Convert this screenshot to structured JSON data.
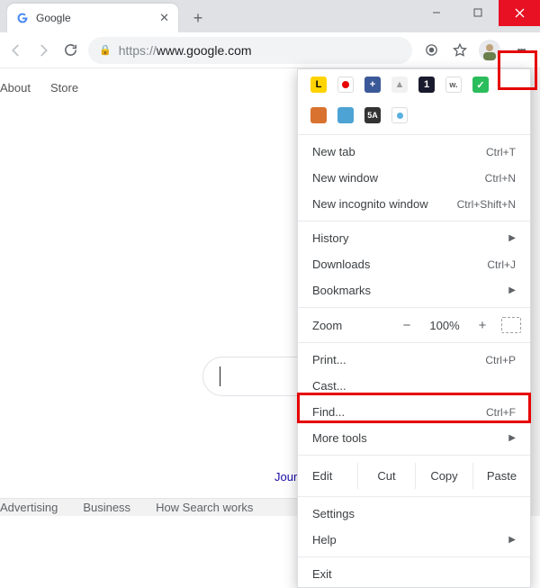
{
  "window": {
    "tab_title": "Google"
  },
  "toolbar": {
    "url_prefix": "https://",
    "url_rest": "www.google.com"
  },
  "page_nav": {
    "about": "About",
    "store": "Store"
  },
  "page": {
    "bottom_link": "Journ"
  },
  "footer": {
    "advertising": "Advertising",
    "business": "Business",
    "how_search": "How Search works"
  },
  "menu": {
    "new_tab": "New tab",
    "new_tab_sc": "Ctrl+T",
    "new_window": "New window",
    "new_window_sc": "Ctrl+N",
    "incognito": "New incognito window",
    "incognito_sc": "Ctrl+Shift+N",
    "history": "History",
    "downloads": "Downloads",
    "downloads_sc": "Ctrl+J",
    "bookmarks": "Bookmarks",
    "zoom_label": "Zoom",
    "zoom_value": "100%",
    "print": "Print...",
    "print_sc": "Ctrl+P",
    "cast": "Cast...",
    "find": "Find...",
    "find_sc": "Ctrl+F",
    "more_tools": "More tools",
    "edit": "Edit",
    "cut": "Cut",
    "copy": "Copy",
    "paste": "Paste",
    "settings": "Settings",
    "help": "Help",
    "exit": "Exit"
  }
}
